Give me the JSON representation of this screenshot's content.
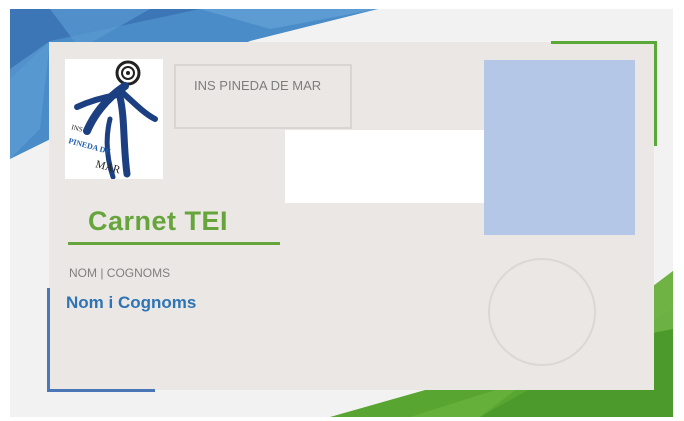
{
  "card": {
    "school_name": "INS PINEDA DE MAR",
    "title": "Carnet TEI",
    "name_label": "NOM | COGNOMS",
    "name_value": "Nom i Cognoms",
    "logo_text_top": "INS",
    "logo_text_mid": "PINEDA DE",
    "logo_text_bottom": "MAR"
  },
  "colors": {
    "green_accent": "#66a53b",
    "blue_accent": "#2e74b5",
    "photo_placeholder": "#b4c7e7",
    "card_background": "#ebe7e4"
  },
  "icons": {
    "logo": "ins-pineda-de-mar-logo",
    "stamp": "stamp-circle"
  }
}
